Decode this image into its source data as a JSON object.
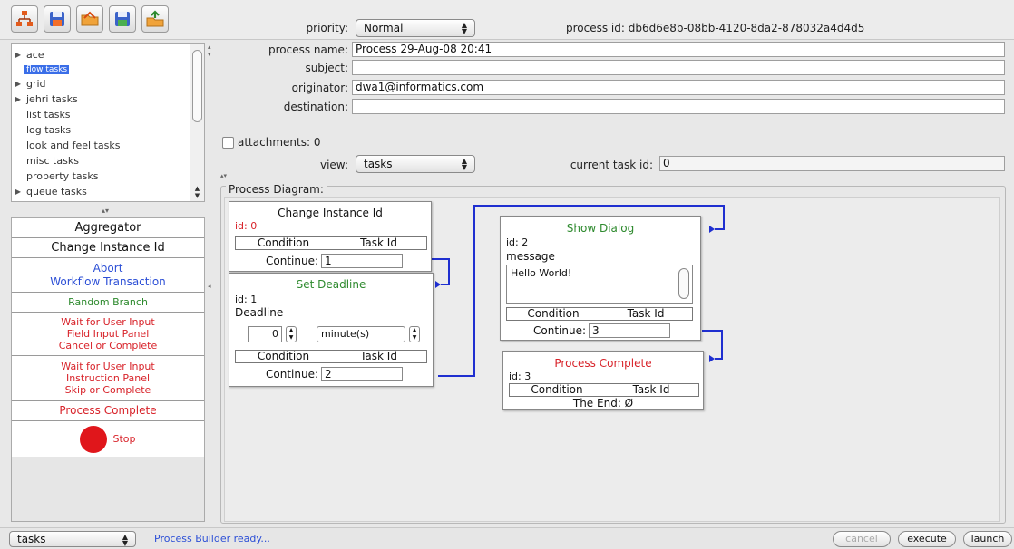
{
  "toolbar": {
    "buttons": [
      {
        "icon": "process-tree-icon"
      },
      {
        "icon": "save-icon"
      },
      {
        "icon": "open-folder-icon"
      },
      {
        "icon": "save-as-icon"
      },
      {
        "icon": "upload-icon"
      }
    ]
  },
  "tree": {
    "items": [
      {
        "label": "ace",
        "expandable": true,
        "selected": false
      },
      {
        "label": "flow tasks",
        "expandable": false,
        "selected": true
      },
      {
        "label": "grid",
        "expandable": true,
        "selected": false
      },
      {
        "label": "jehri tasks",
        "expandable": true,
        "selected": false
      },
      {
        "label": "list tasks",
        "expandable": false,
        "selected": false
      },
      {
        "label": "log tasks",
        "expandable": false,
        "selected": false
      },
      {
        "label": "look and feel tasks",
        "expandable": false,
        "selected": false
      },
      {
        "label": "misc tasks",
        "expandable": false,
        "selected": false
      },
      {
        "label": "property tasks",
        "expandable": false,
        "selected": false
      },
      {
        "label": "queue tasks",
        "expandable": true,
        "selected": false
      }
    ]
  },
  "palette": {
    "aggregator": "Aggregator",
    "change_instance": "Change Instance Id",
    "abort_1": "Abort",
    "abort_2": "Workflow Transaction",
    "random_branch": "Random Branch",
    "wait1_1": "Wait for User Input",
    "wait1_2": "Field Input Panel",
    "wait1_3": "Cancel or Complete",
    "wait2_1": "Wait for User Input",
    "wait2_2": "Instruction Panel",
    "wait2_3": "Skip or Complete",
    "process_complete": "Process Complete",
    "stop": "Stop"
  },
  "form": {
    "priority_label": "priority:",
    "priority_value": "Normal",
    "process_id_label": "process id:",
    "process_id_value": "db6d6e8b-08bb-4120-8da2-878032a4d4d5",
    "process_name_label": "process name:",
    "process_name_value": "Process 29-Aug-08 20:41",
    "subject_label": "subject:",
    "subject_value": "",
    "originator_label": "originator:",
    "originator_value": "dwa1@informatics.com",
    "destination_label": "destination:",
    "destination_value": "",
    "attachments_label": "attachments:",
    "attachments_count": "0",
    "view_label": "view:",
    "view_value": "tasks",
    "current_task_label": "current task id:",
    "current_task_value": "0"
  },
  "diagram": {
    "title": "Process Diagram:",
    "nodes": {
      "change": {
        "title": "Change Instance Id",
        "id_text": "id: 0",
        "cond": "Condition",
        "task": "Task Id",
        "cont_label": "Continue:",
        "cont_value": "1"
      },
      "deadline": {
        "title": "Set Deadline",
        "id_text": "id: 1",
        "label": "Deadline",
        "amount": "0",
        "unit": "minute(s)",
        "cond": "Condition",
        "task": "Task Id",
        "cont_label": "Continue:",
        "cont_value": "2"
      },
      "dialog": {
        "title": "Show Dialog",
        "id_text": "id: 2",
        "label": "message",
        "message": "Hello World!",
        "cond": "Condition",
        "task": "Task Id",
        "cont_label": "Continue:",
        "cont_value": "3"
      },
      "complete": {
        "title": "Process Complete",
        "id_text": "id: 3",
        "cond": "Condition",
        "task": "Task Id",
        "end_text": "The End: Ø"
      }
    }
  },
  "status": {
    "view_value": "tasks",
    "message": "Process Builder ready...",
    "cancel": "cancel",
    "execute": "execute",
    "launch": "launch"
  },
  "colors": {
    "green_title": "#2e8a2e",
    "red_title": "#d8232a",
    "connector": "#1f2fd0",
    "selection": "#3a6ee8"
  }
}
